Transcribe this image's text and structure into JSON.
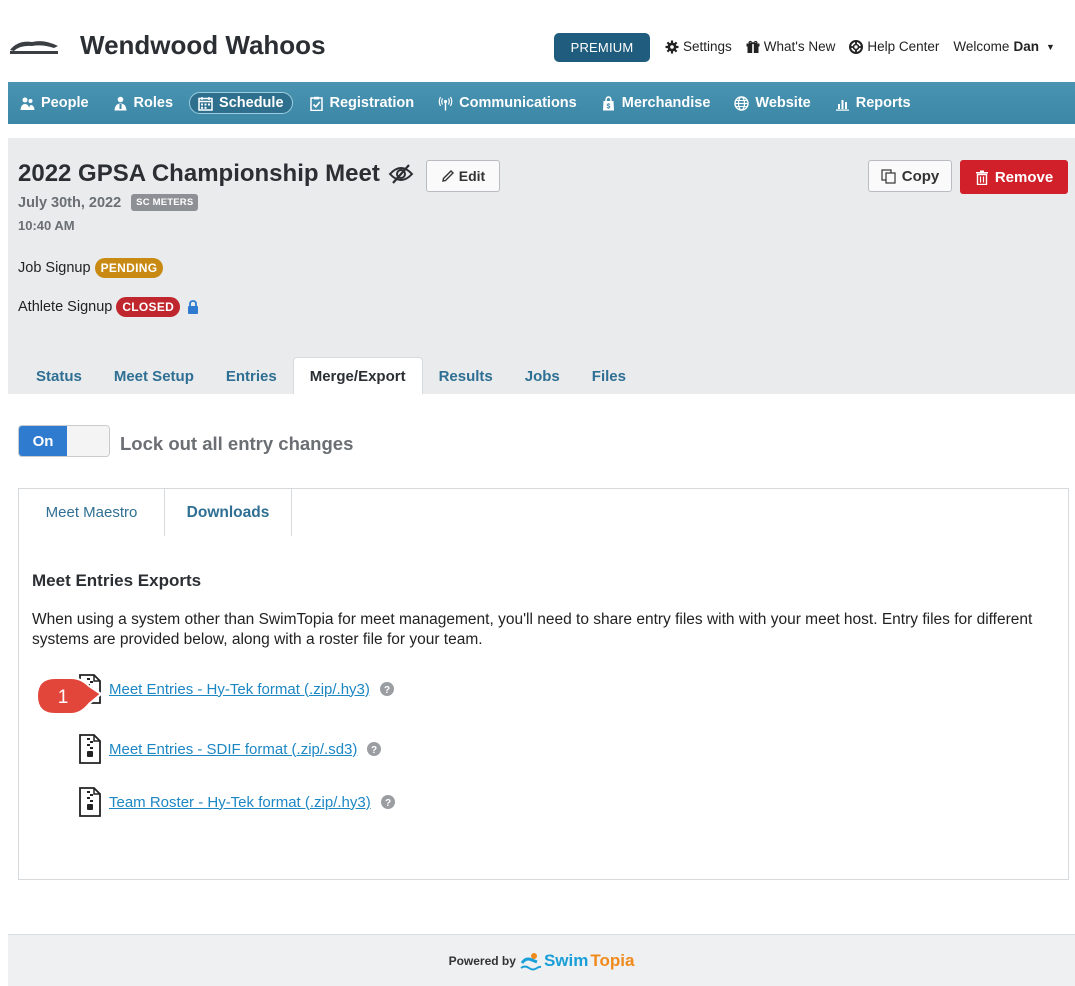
{
  "header": {
    "team_name": "Wendwood Wahoos",
    "premium_label": "PREMIUM",
    "settings_label": "Settings",
    "whats_new_label": "What's New",
    "help_center_label": "Help Center",
    "welcome_label": "Welcome",
    "user_name": "Dan"
  },
  "nav": {
    "items": [
      {
        "label": "People",
        "icon": "people-icon"
      },
      {
        "label": "Roles",
        "icon": "roles-icon"
      },
      {
        "label": "Schedule",
        "icon": "calendar-icon",
        "active": true
      },
      {
        "label": "Registration",
        "icon": "clipboard-icon"
      },
      {
        "label": "Communications",
        "icon": "broadcast-icon"
      },
      {
        "label": "Merchandise",
        "icon": "bag-icon"
      },
      {
        "label": "Website",
        "icon": "globe-icon"
      },
      {
        "label": "Reports",
        "icon": "bar-chart-icon"
      }
    ]
  },
  "meet": {
    "title": "2022 GPSA Championship Meet",
    "edit_label": "Edit",
    "copy_label": "Copy",
    "remove_label": "Remove",
    "date": "July 30th, 2022",
    "course": "SC METERS",
    "time": "10:40 AM",
    "job_signup_label": "Job Signup",
    "job_signup_status": "PENDING",
    "athlete_signup_label": "Athlete Signup",
    "athlete_signup_status": "CLOSED"
  },
  "tabs": {
    "items": [
      "Status",
      "Meet Setup",
      "Entries",
      "Merge/Export",
      "Results",
      "Jobs",
      "Files"
    ],
    "active": "Merge/Export"
  },
  "lock": {
    "toggle_label": "On",
    "label": "Lock out all entry changes"
  },
  "subtabs": {
    "meet_maestro": "Meet Maestro",
    "downloads": "Downloads"
  },
  "exports": {
    "title": "Meet Entries Exports",
    "description": "When using a system other than SwimTopia for meet management, you'll need to share entry files with with your meet host. Entry files for different systems are provided below, along with a roster file for your team.",
    "links": [
      "Meet Entries - Hy-Tek format (.zip/.hy3)",
      "Meet Entries - SDIF format (.zip/.sd3)",
      "Team Roster - Hy-Tek format (.zip/.hy3)"
    ]
  },
  "callout": {
    "number": "1"
  },
  "footer": {
    "powered_by": "Powered by",
    "brand_swim": "Swim",
    "brand_topia": "Topia"
  },
  "colors": {
    "nav_blue": "#3c86a6",
    "premium": "#1f5c7e",
    "remove_red": "#d2202a",
    "pending": "#c88a12",
    "closed": "#c0262d",
    "toggle_on": "#2f7bd0",
    "link": "#1d87c4",
    "callout": "#e2463a"
  }
}
